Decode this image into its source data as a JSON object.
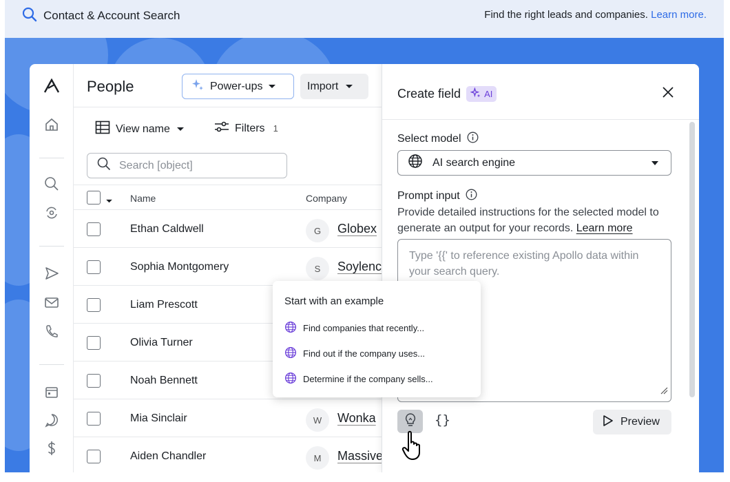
{
  "banner": {
    "title": "Contact & Account Search",
    "tagline": "Find the right leads and companies.",
    "link": "Learn more."
  },
  "people": {
    "title": "People",
    "powerups_label": "Power-ups",
    "import_label": "Import",
    "view_label": "View name",
    "filters_label": "Filters",
    "filters_count": "1",
    "search_placeholder": "Search [object]",
    "columns": [
      "Name",
      "Company"
    ],
    "rows": [
      {
        "name": "Ethan Caldwell",
        "initial": "G",
        "company": "Globex"
      },
      {
        "name": "Sophia Montgomery",
        "initial": "S",
        "company": "Soylenc"
      },
      {
        "name": "Liam Prescott",
        "initial": "",
        "company": ""
      },
      {
        "name": "Olivia Turner",
        "initial": "",
        "company": ""
      },
      {
        "name": "Noah Bennett",
        "initial": "",
        "company": ""
      },
      {
        "name": "Mia Sinclair",
        "initial": "W",
        "company": "Wonka"
      },
      {
        "name": "Aiden Chandler",
        "initial": "M",
        "company": "Massive"
      }
    ]
  },
  "panel": {
    "title": "Create field",
    "ai_badge": "AI",
    "model_label": "Select model",
    "model_value": "AI search engine",
    "prompt_label": "Prompt input",
    "help_text": "Provide detailed instructions for the selected model to generate an output for your records.",
    "help_link": "Learn more",
    "prompt_placeholder": "Type '{{' to reference existing Apollo data within your search query.",
    "braces_label": "{}",
    "preview_label": "Preview"
  },
  "examples": {
    "title": "Start with an example",
    "items": [
      "Find companies that recently...",
      "Find out if the company uses...",
      "Determine if the company sells..."
    ]
  },
  "colors": {
    "accent": "#2e6be6",
    "background": "#3b7be4",
    "ai_purple": "#6b3fd9"
  },
  "icons": {
    "rail": [
      "logo-icon",
      "home-icon",
      "search-icon",
      "refresh-icon",
      "send-icon",
      "mail-icon",
      "phone-icon",
      "calendar-icon",
      "chat-icon",
      "dollar-icon"
    ]
  }
}
